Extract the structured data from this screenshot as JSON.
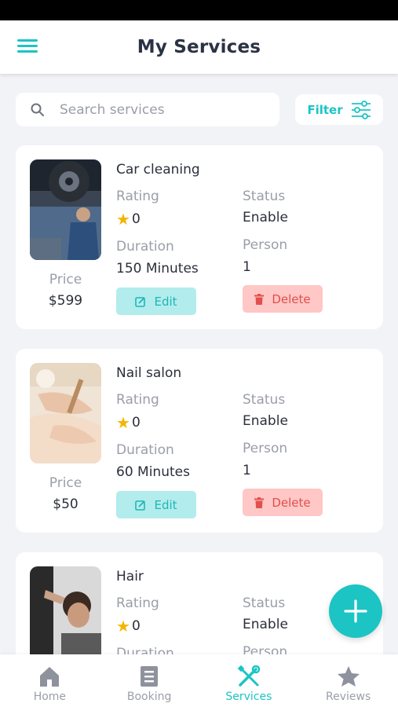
{
  "header": {
    "title": "My Services"
  },
  "search": {
    "placeholder": "Search services",
    "filter_label": "Filter"
  },
  "labels": {
    "price": "Price",
    "rating": "Rating",
    "status": "Status",
    "duration": "Duration",
    "person": "Person",
    "edit": "Edit",
    "delete": "Delete"
  },
  "services": [
    {
      "name": "Car cleaning",
      "price": "$599",
      "rating": "0",
      "status": "Enable",
      "duration": "150  Minutes",
      "person": "1"
    },
    {
      "name": "Nail salon",
      "price": "$50",
      "rating": "0",
      "status": "Enable",
      "duration": "60  Minutes",
      "person": "1"
    },
    {
      "name": "Hair",
      "price": "",
      "rating": "0",
      "status": "Enable",
      "duration": "",
      "person": ""
    }
  ],
  "nav": {
    "items": [
      {
        "label": "Home",
        "icon": "home-icon"
      },
      {
        "label": "Booking",
        "icon": "booking-icon"
      },
      {
        "label": "Services",
        "icon": "tools-icon",
        "active": true
      },
      {
        "label": "Reviews",
        "icon": "star-icon"
      }
    ]
  },
  "colors": {
    "accent": "#1cc4c4",
    "danger": "#e0504d",
    "star": "#f5b400"
  }
}
